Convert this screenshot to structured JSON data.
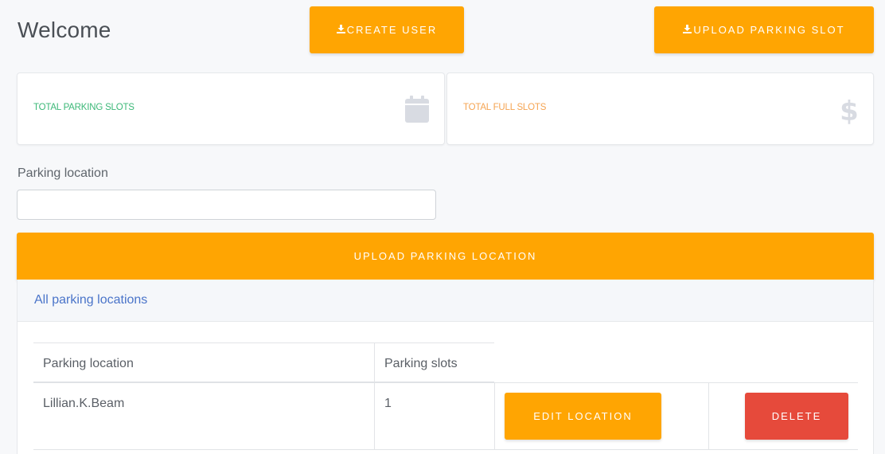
{
  "header": {
    "title": "Welcome",
    "create_user_label": "CREATE USER",
    "upload_slot_label": "UPLOAD PARKING SLOT",
    "download_icon": "download-icon"
  },
  "stats": [
    {
      "label": "TOTAL PARKING SLOTS",
      "icon": "calendar-icon",
      "color": "#3cb878"
    },
    {
      "label": "TOTAL FULL SLOTS",
      "icon": "dollar-icon",
      "color": "#f5a452"
    }
  ],
  "form": {
    "location_label": "Parking location",
    "location_value": "",
    "location_placeholder": "",
    "submit_label": "UPLOAD PARKING LOCATION"
  },
  "panel": {
    "title": "All parking locations",
    "columns": [
      "Parking location",
      "Parking slots"
    ],
    "rows": [
      {
        "location": "Lillian.K.Beam",
        "slots": "1",
        "edit_label": "EDIT LOCATION",
        "delete_label": "DELETE"
      }
    ]
  },
  "colors": {
    "accent": "#ffa502",
    "danger": "#e64a3b",
    "link": "#4a74c9",
    "background": "#f7f8fa"
  }
}
